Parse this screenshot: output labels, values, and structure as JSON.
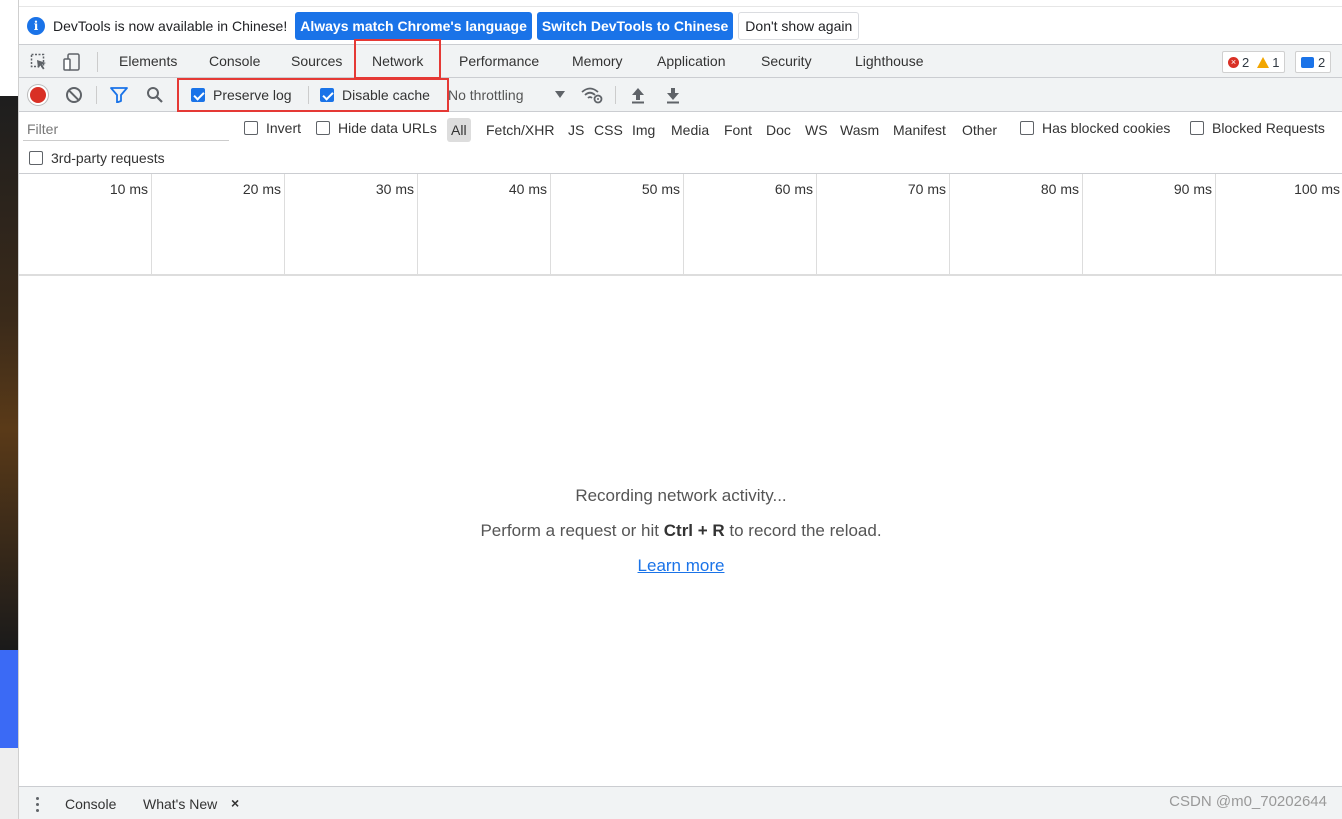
{
  "infobar": {
    "message": "DevTools is now available in Chinese!",
    "btn_match": "Always match Chrome's language",
    "btn_switch": "Switch DevTools to Chinese",
    "btn_dismiss": "Don't show again"
  },
  "tabs": {
    "elements": "Elements",
    "console": "Console",
    "sources": "Sources",
    "network": "Network",
    "performance": "Performance",
    "memory": "Memory",
    "application": "Application",
    "security": "Security",
    "lighthouse": "Lighthouse"
  },
  "counters": {
    "errors": "2",
    "warnings": "1",
    "messages": "2"
  },
  "network_toolbar": {
    "preserve_log": "Preserve log",
    "disable_cache": "Disable cache",
    "throttling": "No throttling"
  },
  "filter": {
    "placeholder": "Filter",
    "invert": "Invert",
    "hide_data_urls": "Hide data URLs",
    "types": [
      "All",
      "Fetch/XHR",
      "JS",
      "CSS",
      "Img",
      "Media",
      "Font",
      "Doc",
      "WS",
      "Wasm",
      "Manifest",
      "Other"
    ],
    "has_blocked_cookies": "Has blocked cookies",
    "blocked_requests": "Blocked Requests",
    "third_party": "3rd-party requests"
  },
  "timeline": {
    "ticks": [
      "10 ms",
      "20 ms",
      "30 ms",
      "40 ms",
      "50 ms",
      "60 ms",
      "70 ms",
      "80 ms",
      "90 ms",
      "100 ms"
    ]
  },
  "empty_state": {
    "line1": "Recording network activity...",
    "line2_prefix": "Perform a request or hit ",
    "line2_key": "Ctrl + R",
    "line2_suffix": " to record the reload.",
    "link": "Learn more"
  },
  "drawer": {
    "console": "Console",
    "whats_new": "What's New",
    "close": "×"
  },
  "watermark": "CSDN @m0_70202644",
  "colors": {
    "accent": "#1a73e8",
    "highlight": "#e53935",
    "record": "#d93025"
  }
}
